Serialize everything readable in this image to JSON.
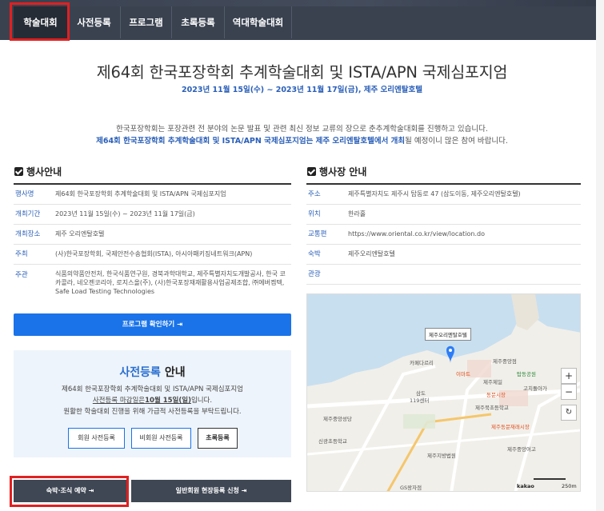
{
  "nav": {
    "items": [
      {
        "label": "학술대회"
      },
      {
        "label": "사전등록"
      },
      {
        "label": "프로그램"
      },
      {
        "label": "초록등록"
      },
      {
        "label": "역대학술대회"
      }
    ]
  },
  "header": {
    "title": "제64회 한국포장학회 추계학술대회 및 ISTA/APN 국제심포지엄",
    "dates": "2023년 11월 15일(수) ~ 2023년 11월 17일(금), 제주 오리엔탈호텔"
  },
  "intro": {
    "line1": "한국포장학회는 포장관련 전 분야의 논문 발표 및 관련 최신 정보 교류의 장으로 춘추계학술대회를 진행하고 있습니다.",
    "line2_blue": "제64회 한국포장학회 추계학술대회 및 ISTA/APN 국제심포지엄는 제주 오리엔탈호텔에서 개최",
    "line2_rest": "될 예정이니 많은 참여 바랍니다."
  },
  "event_info": {
    "heading": "행사안내",
    "rows": [
      {
        "key": "행사명",
        "value": "제64회 한국포장학회 추계학술대회 및 ISTA/APN 국제심포지엄"
      },
      {
        "key": "개최기간",
        "value": "2023년 11월 15일(수) ~ 2023년 11월 17일(금)"
      },
      {
        "key": "개최장소",
        "value": "제주 오리엔탈호텔"
      },
      {
        "key": "주최",
        "value": "(사)한국포장학회, 국제안전수송협회(ISTA), 아시아패키징네트워크(APN)"
      },
      {
        "key": "주관",
        "value": "식품의약품안전처, 한국식품연구원, 경북과학대학교, 제주특별자치도개발공사, 한국 코카콜라, 네오젠코리아, 로지스올(주), (사)한국포장재재활용사업공제조합, ㈜에버켐텍, Safe Load Testing Technologies"
      }
    ]
  },
  "venue_info": {
    "heading": "행사장 안내",
    "rows": [
      {
        "key": "주소",
        "value": "제주특별자치도 제주시 탑동로 47 (삼도이동, 제주오리엔탈호텔)"
      },
      {
        "key": "위치",
        "value": "한라홀"
      },
      {
        "key": "교통편",
        "value": "https://www.oriental.co.kr/view/location.do"
      },
      {
        "key": "숙박",
        "value": "제주오리엔탈호텔"
      },
      {
        "key": "관광",
        "value": ""
      }
    ]
  },
  "program_button": "프로그램 확인하기",
  "registration": {
    "title_blue": "사전등록",
    "title_dark": "안내",
    "line1": "제64회 한국포장학회 추계학술대회 및 ISTA/APN 국제심포지엄",
    "line2_pre": "사전등록 마감일은",
    "line2_date": "10월 15일(일)",
    "line2_post": "입니다.",
    "line3": "원활한 학술대회 진행을 위해 가급적 사전등록을 부탁드립니다.",
    "buttons": [
      "회원 사전등록",
      "비회원 사전등록",
      "초록등록"
    ]
  },
  "bottom_buttons": {
    "lodging": "숙박·조식 예약",
    "onsite": "일반회원 현장등록 신청"
  },
  "map": {
    "tooltip": "제주오리엔탈호텔",
    "scale_brand": "kakao",
    "scale_label": "250m",
    "zoom_in": "+",
    "zoom_out": "−",
    "refresh": "↻",
    "labels": [
      "카페다르리",
      "제주중앙점",
      "이마트",
      "탑동공원",
      "제주제일",
      "삼도",
      "119센터",
      "동문시장",
      "고치돌아가",
      "제주북초등학교",
      "제주중앙성당",
      "GS왕자점",
      "제주동문재래시장",
      "신광초등학교",
      "제주지방법원",
      "제주중앙여고"
    ]
  },
  "colors": {
    "nav_bg": "#3a4250",
    "nav_active": "#262c36",
    "accent_blue": "#1a73e8",
    "highlight_red": "#e02020"
  }
}
